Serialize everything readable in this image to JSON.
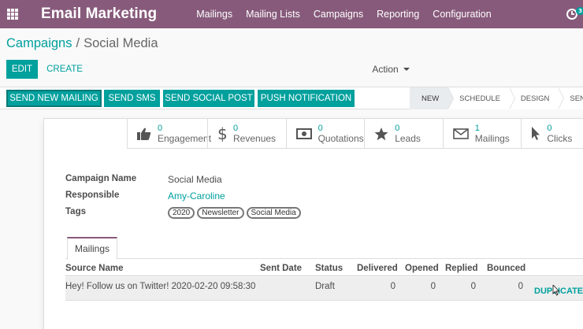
{
  "navbar": {
    "app_title": "Email Marketing",
    "menu": [
      "Mailings",
      "Mailing Lists",
      "Campaigns",
      "Reporting",
      "Configuration"
    ],
    "activity_count": "3"
  },
  "breadcrumb": {
    "parent": "Campaigns",
    "separator": "/",
    "current": "Social Media"
  },
  "toolbar": {
    "edit": "EDIT",
    "create": "CREATE",
    "action": "Action"
  },
  "header_buttons": [
    "SEND NEW MAILING",
    "SEND SMS",
    "SEND SOCIAL POST",
    "PUSH NOTIFICATION"
  ],
  "stages": [
    {
      "label": "NEW",
      "active": true
    },
    {
      "label": "SCHEDULE",
      "active": false
    },
    {
      "label": "DESIGN",
      "active": false
    },
    {
      "label": "SENT",
      "active": false
    }
  ],
  "stat_buttons": [
    {
      "value": "0",
      "label": "Engagement",
      "icon": "thumbs-up-icon"
    },
    {
      "value": "0",
      "label": "Revenues",
      "icon": "dollar-icon"
    },
    {
      "value": "0",
      "label": "Quotations",
      "icon": "money-icon"
    },
    {
      "value": "0",
      "label": "Leads",
      "icon": "star-icon"
    },
    {
      "value": "1",
      "label": "Mailings",
      "icon": "envelope-icon"
    },
    {
      "value": "0",
      "label": "Clicks",
      "icon": "cursor-icon"
    }
  ],
  "fields": {
    "campaign_name_label": "Campaign Name",
    "campaign_name": "Social Media",
    "responsible_label": "Responsible",
    "responsible": "Amy-Caroline",
    "tags_label": "Tags",
    "tags": [
      "2020",
      "Newsletter",
      "Social Media"
    ]
  },
  "tab": {
    "label": "Mailings"
  },
  "table": {
    "columns": [
      "Source Name",
      "Sent Date",
      "Status",
      "Delivered",
      "Opened",
      "Replied",
      "Bounced"
    ],
    "rows": [
      {
        "source_name": "Hey! Follow us on Twitter! 2020-02-20 09:58:30",
        "sent_date": "",
        "status": "Draft",
        "delivered": "0",
        "opened": "0",
        "replied": "0",
        "bounced": "0",
        "action": "DUPLICATE"
      }
    ]
  },
  "colors": {
    "brand": "#875a7b",
    "accent": "#00a09d"
  }
}
